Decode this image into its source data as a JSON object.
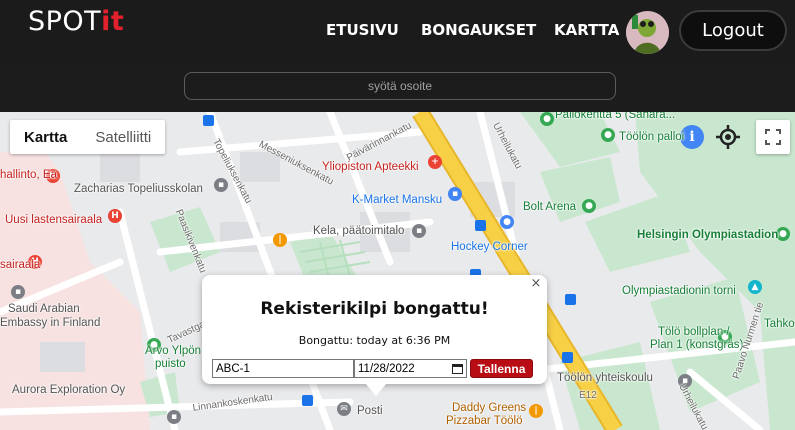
{
  "brand": {
    "prefix": "SPOT",
    "accent": "it"
  },
  "nav": {
    "home": "ETUSIVU",
    "spottings": "BONGAUKSET",
    "map": "KARTTA",
    "logout": "Logout"
  },
  "search": {
    "placeholder": "syötä osoite",
    "value": ""
  },
  "map": {
    "type_map": "Kartta",
    "type_satellite": "Satelliitti",
    "places": {
      "ylioppilas_apteekki": "Yliopiston Apteekki",
      "kmarket": "K-Market Mansku",
      "kela": "Kela, päätoimitalo",
      "hockey_corner": "Hockey Corner",
      "bolt_arena": "Bolt Arena",
      "olympiastadion": "Helsingin Olympiastadion",
      "olympiastadion_torni": "Olympiastadionin torni",
      "toolo_palloi": "Töölön palloi",
      "pallokentta": "Pallokenttä 5 (Sahara...",
      "topelius": "Zacharias Topeliusskolan",
      "hallinto": "hallinto, Ea",
      "lastensairaala": "Uusi lastensairaala",
      "sairaala": "sairaala",
      "saudi": "Saudi Arabian",
      "saudi_2": "Embassy in Finland",
      "arvo": "Arvo Ylpön",
      "arvo_2": "puisto",
      "aurora": "Aurora Exploration Oy",
      "posti": "Posti",
      "daddy": "Daddy Greens",
      "daddy_2": "Pizzabar Töölö",
      "yhteiskoulu": "Töölön yhteiskoulu",
      "bollplan": "Tölö bollplan /",
      "bollplan_2": "Plan 1 (konstgräs)",
      "tahko": "Tahko",
      "paavo": "Paavo Nurmen tie"
    },
    "streets": {
      "messeniuksenkatu": "Messeniuksenkatu",
      "topeliuksenkatu": "Topeliuksenkatu",
      "paivarinnankatu": "Päivärinnankatu",
      "urheilukatu": "Urheilukatu",
      "urheilukatu_2": "Urheilukatu",
      "paasikivenkatu": "Paasikivenkatu",
      "linnankoskenkatu": "Linnankoskenkatu",
      "tavastgatan": "Tavastgatan",
      "road_id": "E12"
    }
  },
  "infowindow": {
    "title": "Rekisterikilpi bongattu!",
    "spotted": "Bongattu: today at 6:36 PM",
    "plate_value": "ABC-1",
    "date_value": "11/28/2022",
    "save_label": "Tallenna",
    "close": "×"
  },
  "colors": {
    "accent": "#e3212d",
    "navbar": "#1b1b1b",
    "save": "#b80d14",
    "highway": "#f7d046"
  }
}
